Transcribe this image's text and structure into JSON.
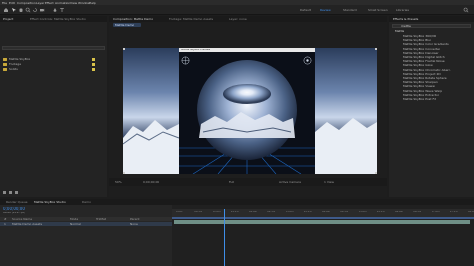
{
  "menu": {
    "items": [
      "File",
      "Edit",
      "Composition",
      "Layer",
      "Effect",
      "Animation",
      "View",
      "Window",
      "Help"
    ]
  },
  "workspaces": {
    "items": [
      "Default",
      "Review",
      "Standard",
      "Small Screen",
      "Libraries"
    ],
    "active": "Review"
  },
  "project": {
    "tabs": [
      "Project",
      "Effect Controls: Mettle SkyBox Studio"
    ],
    "search_placeholder": "",
    "rows": [
      {
        "name": "Mettle SkyBox"
      },
      {
        "name": "Footage"
      },
      {
        "name": "Solids"
      }
    ]
  },
  "comp": {
    "tabs": [
      "Composition: Mettle Demo",
      "Footage: Mettle Demo Assets",
      "Layer: none"
    ],
    "active_tab": "Mettle Demo",
    "inner_popup_title": "Mettle SkyBox Preview",
    "zoom": "50%",
    "time": "0;00;00;00",
    "quality": "Full",
    "view": "Active Camera",
    "views": "1 View"
  },
  "effects": {
    "title": "Effects & Presets",
    "search_value": "mettle",
    "category": "Mettle",
    "items": [
      "Mettle SkyBox 360/VR",
      "Mettle SkyBox Blur",
      "Mettle SkyBox Color Gradients",
      "Mettle SkyBox Converter",
      "Mettle SkyBox Denoiser",
      "Mettle SkyBox Digital Glitch",
      "Mettle SkyBox Fractal Noise",
      "Mettle SkyBox Glow",
      "Mettle SkyBox Chromatic Aberr.",
      "Mettle SkyBox Project 2D",
      "Mettle SkyBox Rotate Sphere",
      "Mettle SkyBox Sharpen",
      "Mettle SkyBox Viewer",
      "Mettle SkyBox Wave Warp",
      "Mettle SkyBox Extractor",
      "Mettle SkyBox Post FX"
    ]
  },
  "timeline": {
    "tabs": [
      "Render Queue",
      "Mettle SkyBox Studio",
      "Demo"
    ],
    "timecode": "0;00;00;00",
    "fps_note": "00000 (29.97 fps)",
    "columns": [
      "#",
      "Source Name",
      "Mode",
      "TrkMat",
      "Parent"
    ],
    "layers": [
      {
        "num": "1",
        "name": "Mettle Demo Assets",
        "mode": "Normal",
        "parent": "None"
      }
    ],
    "ticks": [
      "0:00f",
      "00:15f",
      "01:00f",
      "01:15f",
      "02:00f",
      "02:15f",
      "03:00f",
      "03:15f",
      "04:00f",
      "04:15f",
      "05:00f",
      "05:15f",
      "06:00f",
      "06:15f",
      "07:00f",
      "07:15f",
      "08:00f"
    ]
  }
}
